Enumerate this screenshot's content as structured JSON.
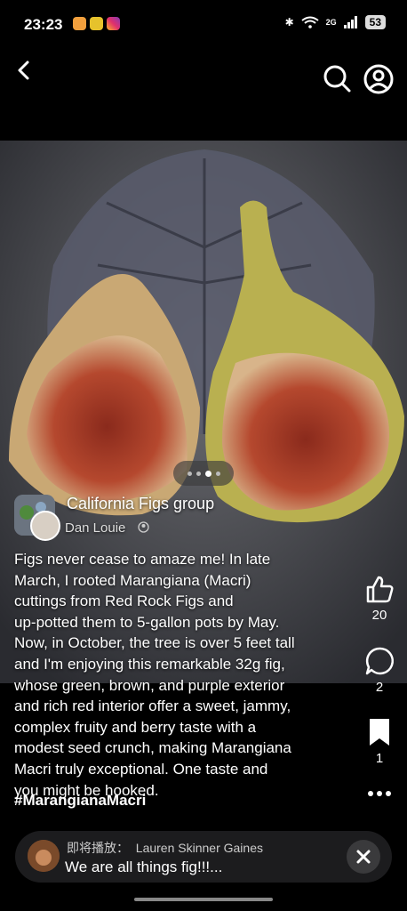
{
  "status_bar": {
    "time": "23:23",
    "network": "2G",
    "battery": "53"
  },
  "group": {
    "name": "California Figs group",
    "author": "Dan Louie"
  },
  "post": {
    "lines": [
      "Figs never cease to amaze me! In late",
      "March, I rooted Marangiana (Macri)",
      "cuttings from Red Rock Figs and",
      "up-potted them to 5-gallon pots by May.",
      "Now, in October, the tree is over 5 feet tall",
      "and I'm enjoying this remarkable 32g fig,",
      "whose green, brown, and purple exterior",
      "and rich red interior offer a sweet, jammy,",
      "complex fruity and berry taste with a",
      "modest seed crunch, making Marangiana",
      "Macri truly exceptional.  One taste and",
      "you might be hooked."
    ],
    "hashtag": "#MarangianaMacri"
  },
  "actions": {
    "likes": "20",
    "comments": "2",
    "saves": "1"
  },
  "player": {
    "label": "即将播放：",
    "artist": "Lauren Skinner Gaines",
    "title": "We are all things fig!!!..."
  },
  "carousel": {
    "pages": 4,
    "active": 2
  },
  "icons": {
    "back": "chevron-left-icon",
    "search": "search-icon",
    "profile": "profile-icon",
    "like": "thumbs-up-icon",
    "comment": "comment-icon",
    "save": "bookmark-icon",
    "more": "more-icon",
    "close": "close-icon"
  }
}
